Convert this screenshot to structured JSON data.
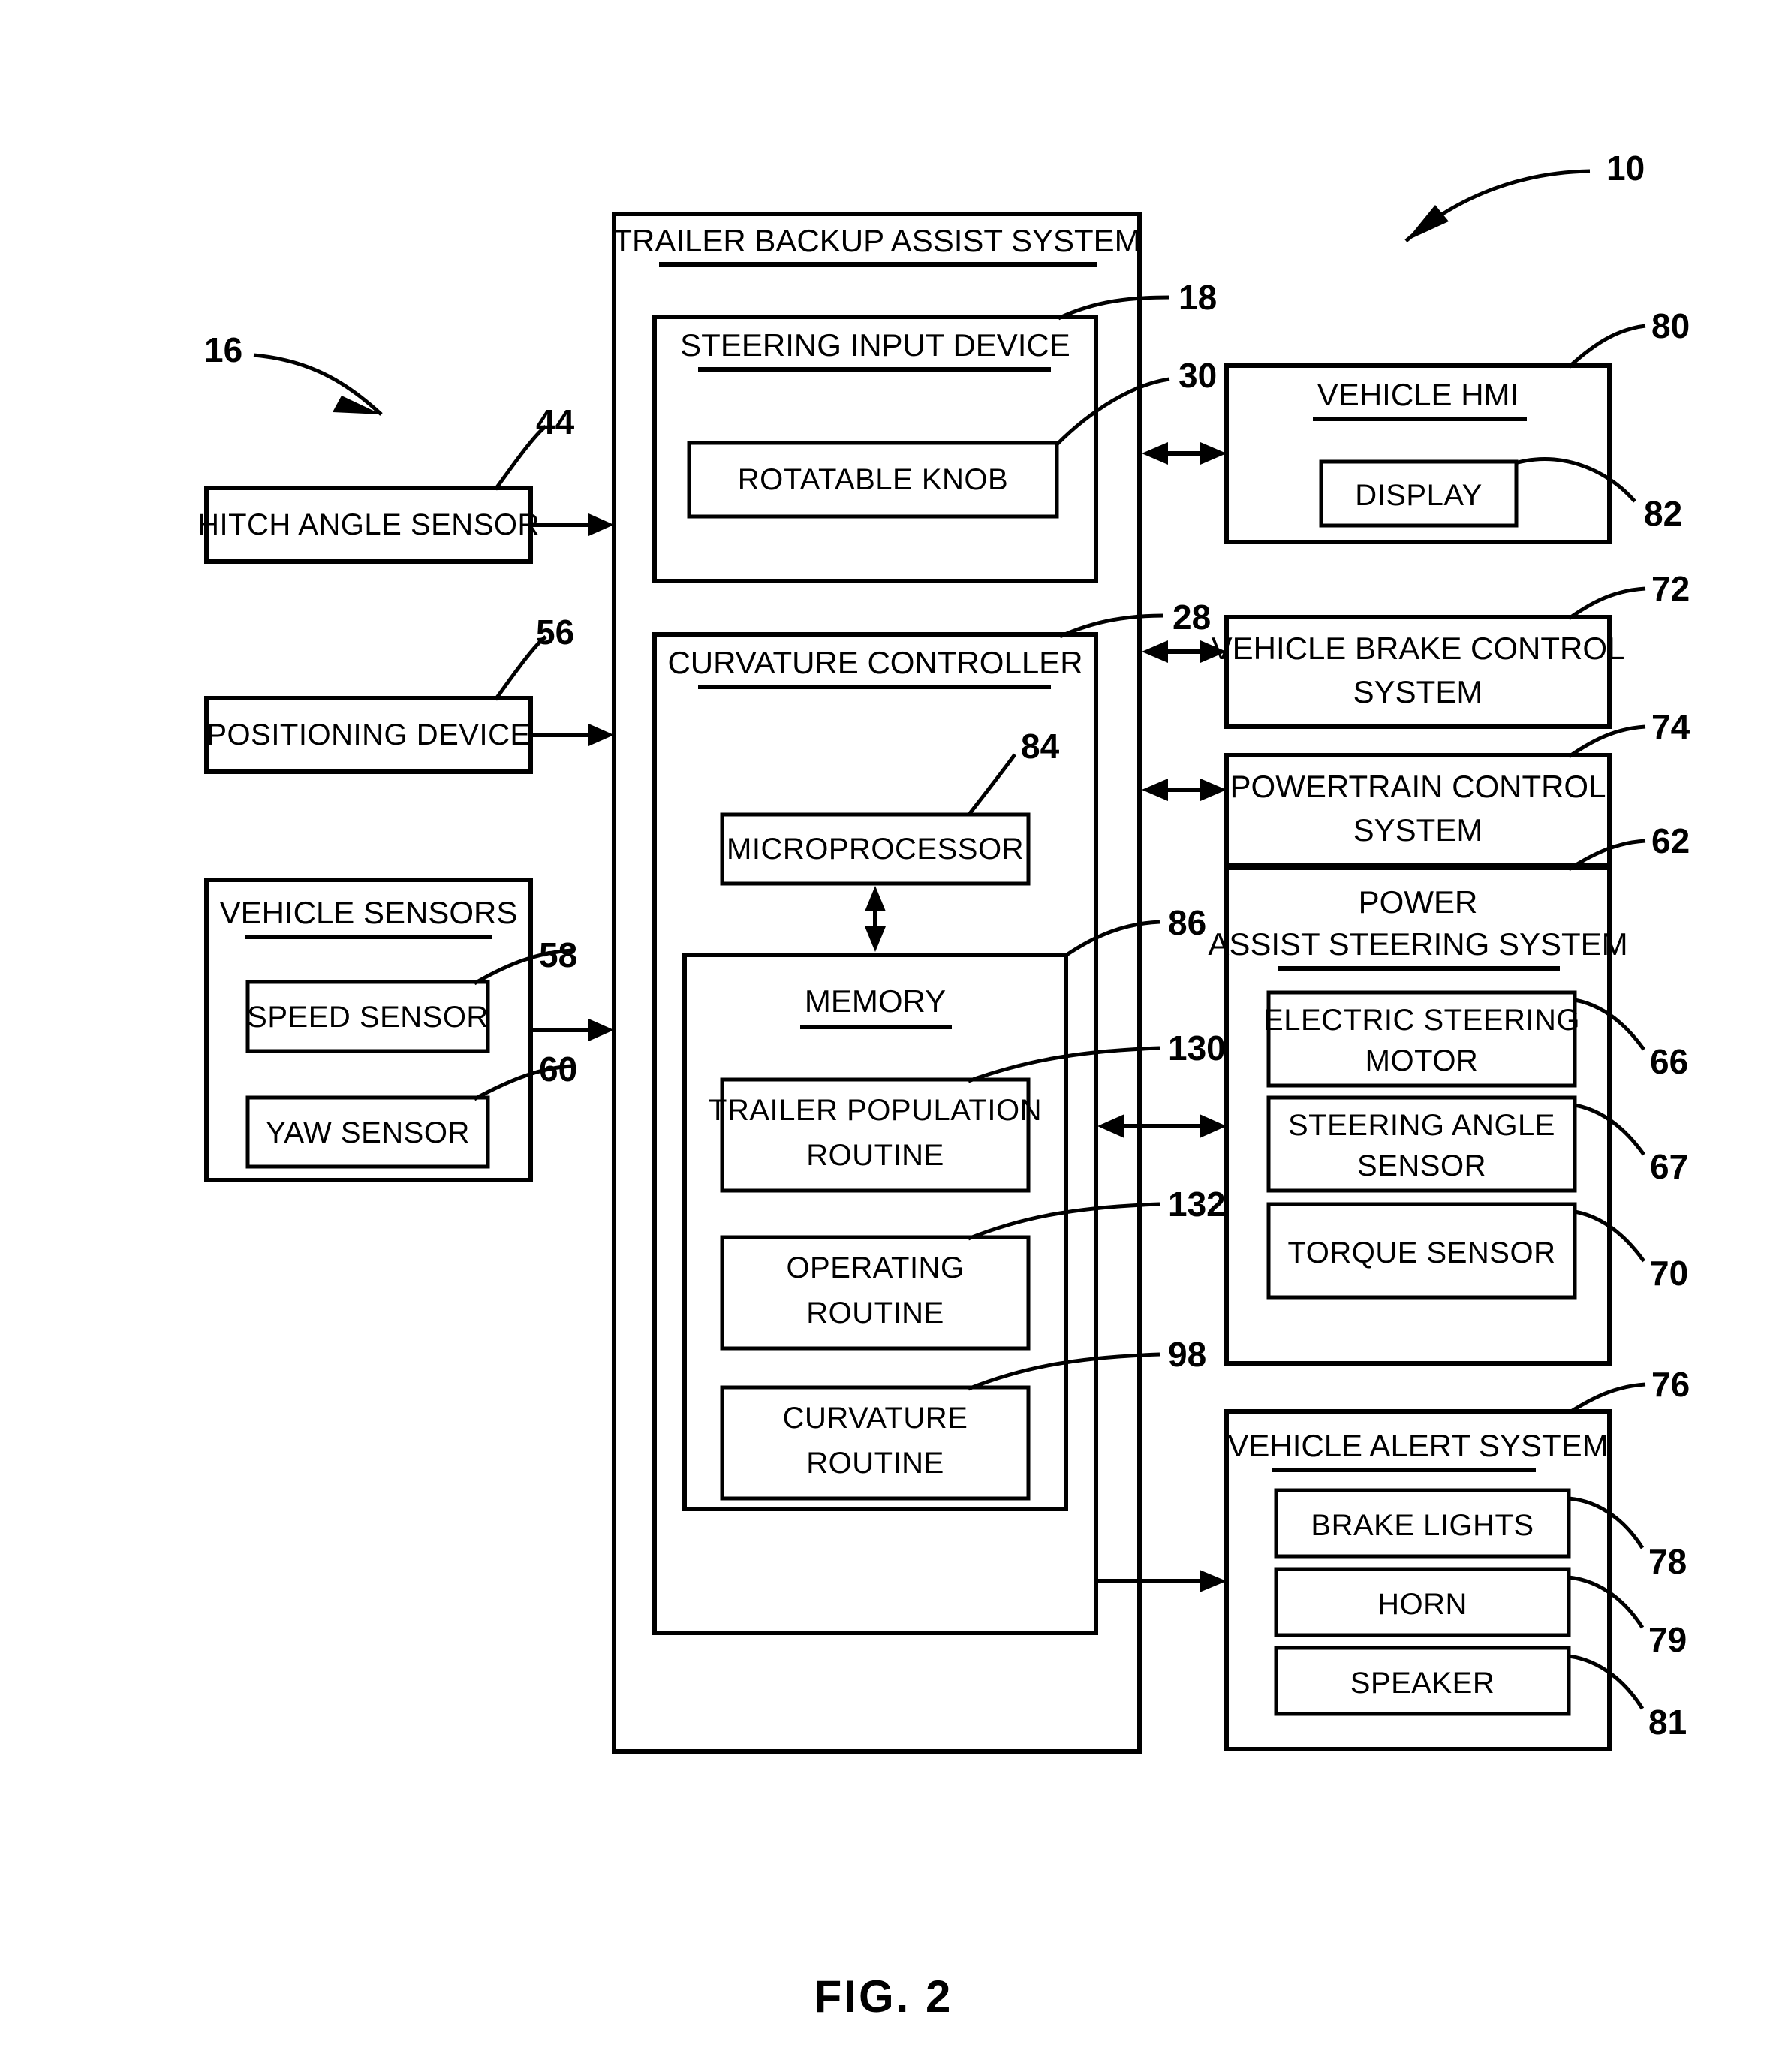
{
  "figure": {
    "caption": "FIG. 2",
    "system_numeral": "10",
    "vehicle_numeral": "16"
  },
  "main_system": {
    "title": "TRAILER BACKUP ASSIST SYSTEM",
    "steering_input_device": {
      "title": "STEERING INPUT DEVICE",
      "numeral": "18",
      "rotatable_knob": {
        "label": "ROTATABLE KNOB",
        "numeral": "30"
      }
    },
    "curvature_controller": {
      "title": "CURVATURE CONTROLLER",
      "numeral": "28",
      "microprocessor": {
        "label": "MICROPROCESSOR",
        "numeral": "84"
      },
      "memory": {
        "title": "MEMORY",
        "numeral": "86",
        "routines": [
          {
            "label": "TRAILER POPULATION ROUTINE",
            "line1": "TRAILER POPULATION",
            "line2": "ROUTINE",
            "numeral": "130"
          },
          {
            "label": "OPERATING ROUTINE",
            "line1": "OPERATING",
            "line2": "ROUTINE",
            "numeral": "132"
          },
          {
            "label": "CURVATURE ROUTINE",
            "line1": "CURVATURE",
            "line2": "ROUTINE",
            "numeral": "98"
          }
        ]
      }
    }
  },
  "left_inputs": [
    {
      "label": "HITCH ANGLE SENSOR",
      "numeral": "44"
    },
    {
      "label": "POSITIONING DEVICE",
      "numeral": "56"
    }
  ],
  "vehicle_sensors": {
    "title": "VEHICLE SENSORS",
    "items": [
      {
        "label": "SPEED SENSOR",
        "numeral": "58"
      },
      {
        "label": "YAW SENSOR",
        "numeral": "60"
      }
    ]
  },
  "vehicle_hmi": {
    "title": "VEHICLE HMI",
    "numeral": "80",
    "display": {
      "label": "DISPLAY",
      "numeral": "82"
    }
  },
  "brake_control": {
    "line1": "VEHICLE BRAKE CONTROL",
    "line2": "SYSTEM",
    "numeral": "72"
  },
  "powertrain_control": {
    "line1": "POWERTRAIN CONTROL",
    "line2": "SYSTEM",
    "numeral": "74"
  },
  "power_assist_steering": {
    "title_line1": "POWER",
    "title_line2": "ASSIST STEERING SYSTEM",
    "numeral": "62",
    "items": [
      {
        "line1": "ELECTRIC STEERING",
        "line2": "MOTOR",
        "label": "ELECTRIC STEERING MOTOR",
        "numeral": "66"
      },
      {
        "line1": "STEERING ANGLE",
        "line2": "SENSOR",
        "label": "STEERING ANGLE SENSOR",
        "numeral": "67"
      },
      {
        "line1": "TORQUE SENSOR",
        "line2": "",
        "label": "TORQUE SENSOR",
        "numeral": "70"
      }
    ]
  },
  "vehicle_alert": {
    "title": "VEHICLE ALERT SYSTEM",
    "numeral": "76",
    "items": [
      {
        "label": "BRAKE LIGHTS",
        "numeral": "78"
      },
      {
        "label": "HORN",
        "numeral": "79"
      },
      {
        "label": "SPEAKER",
        "numeral": "81"
      }
    ]
  },
  "colors": {
    "ink": "#000000",
    "paper": "#ffffff"
  }
}
